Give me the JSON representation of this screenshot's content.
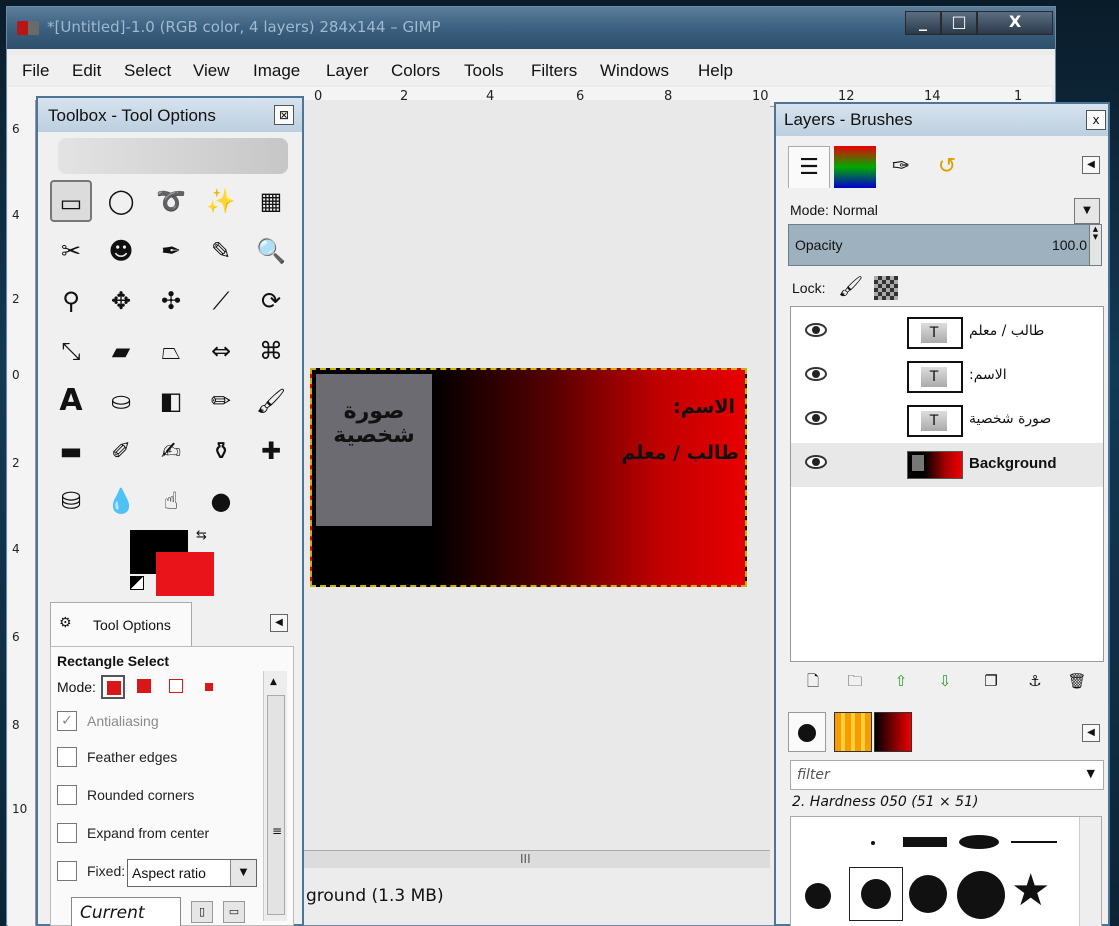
{
  "window": {
    "title": "*[Untitled]-1.0 (RGB color, 4 layers) 284x144 – GIMP",
    "btn_min": "_",
    "btn_max": "□",
    "btn_close": "X"
  },
  "menubar": [
    "File",
    "Edit",
    "Select",
    "View",
    "Image",
    "Layer",
    "Colors",
    "Tools",
    "Filters",
    "Windows",
    "Help"
  ],
  "ruler_top": [
    "0",
    "2",
    "4",
    "6",
    "8",
    "10",
    "12",
    "14",
    "1"
  ],
  "ruler_left": [
    "6",
    "4",
    "2",
    "0",
    "2",
    "4",
    "6",
    "8",
    "10"
  ],
  "toolbox": {
    "title": "Toolbox - Tool Options",
    "close": "⊠",
    "colors": {
      "foreground": "#000000",
      "background": "#e8141a"
    }
  },
  "tool_options": {
    "tab_label": "Tool Options",
    "tab_icon": "⚙",
    "tool_name": "Rectangle Select",
    "mode_label": "Mode:",
    "antialiasing": "Antialiasing",
    "feather": "Feather edges",
    "rounded": "Rounded corners",
    "expand": "Expand from center",
    "fixed": "Fixed:",
    "fixed_value": "Aspect ratio",
    "current": "Current"
  },
  "canvas": {
    "photo_text": "صورة شخصية",
    "name_label": "الاسم:",
    "role_label": "طالب / معلم"
  },
  "status": {
    "text": "ground (1.3 MB)"
  },
  "layers_panel": {
    "title": "Layers - Brushes",
    "close": "x",
    "mode": "Mode: Normal",
    "opacity_label": "Opacity",
    "opacity_value": "100.0",
    "lock_label": "Lock:",
    "layers": [
      {
        "name": "طالب / معلم",
        "visible": true
      },
      {
        "name": "الاسم:",
        "visible": true
      },
      {
        "name": "صورة شخصية",
        "visible": true
      },
      {
        "name": "Background",
        "visible": true
      }
    ]
  },
  "brushes": {
    "filter_placeholder": "filter",
    "selected_brush": "2. Hardness 050 (51 × 51)"
  }
}
